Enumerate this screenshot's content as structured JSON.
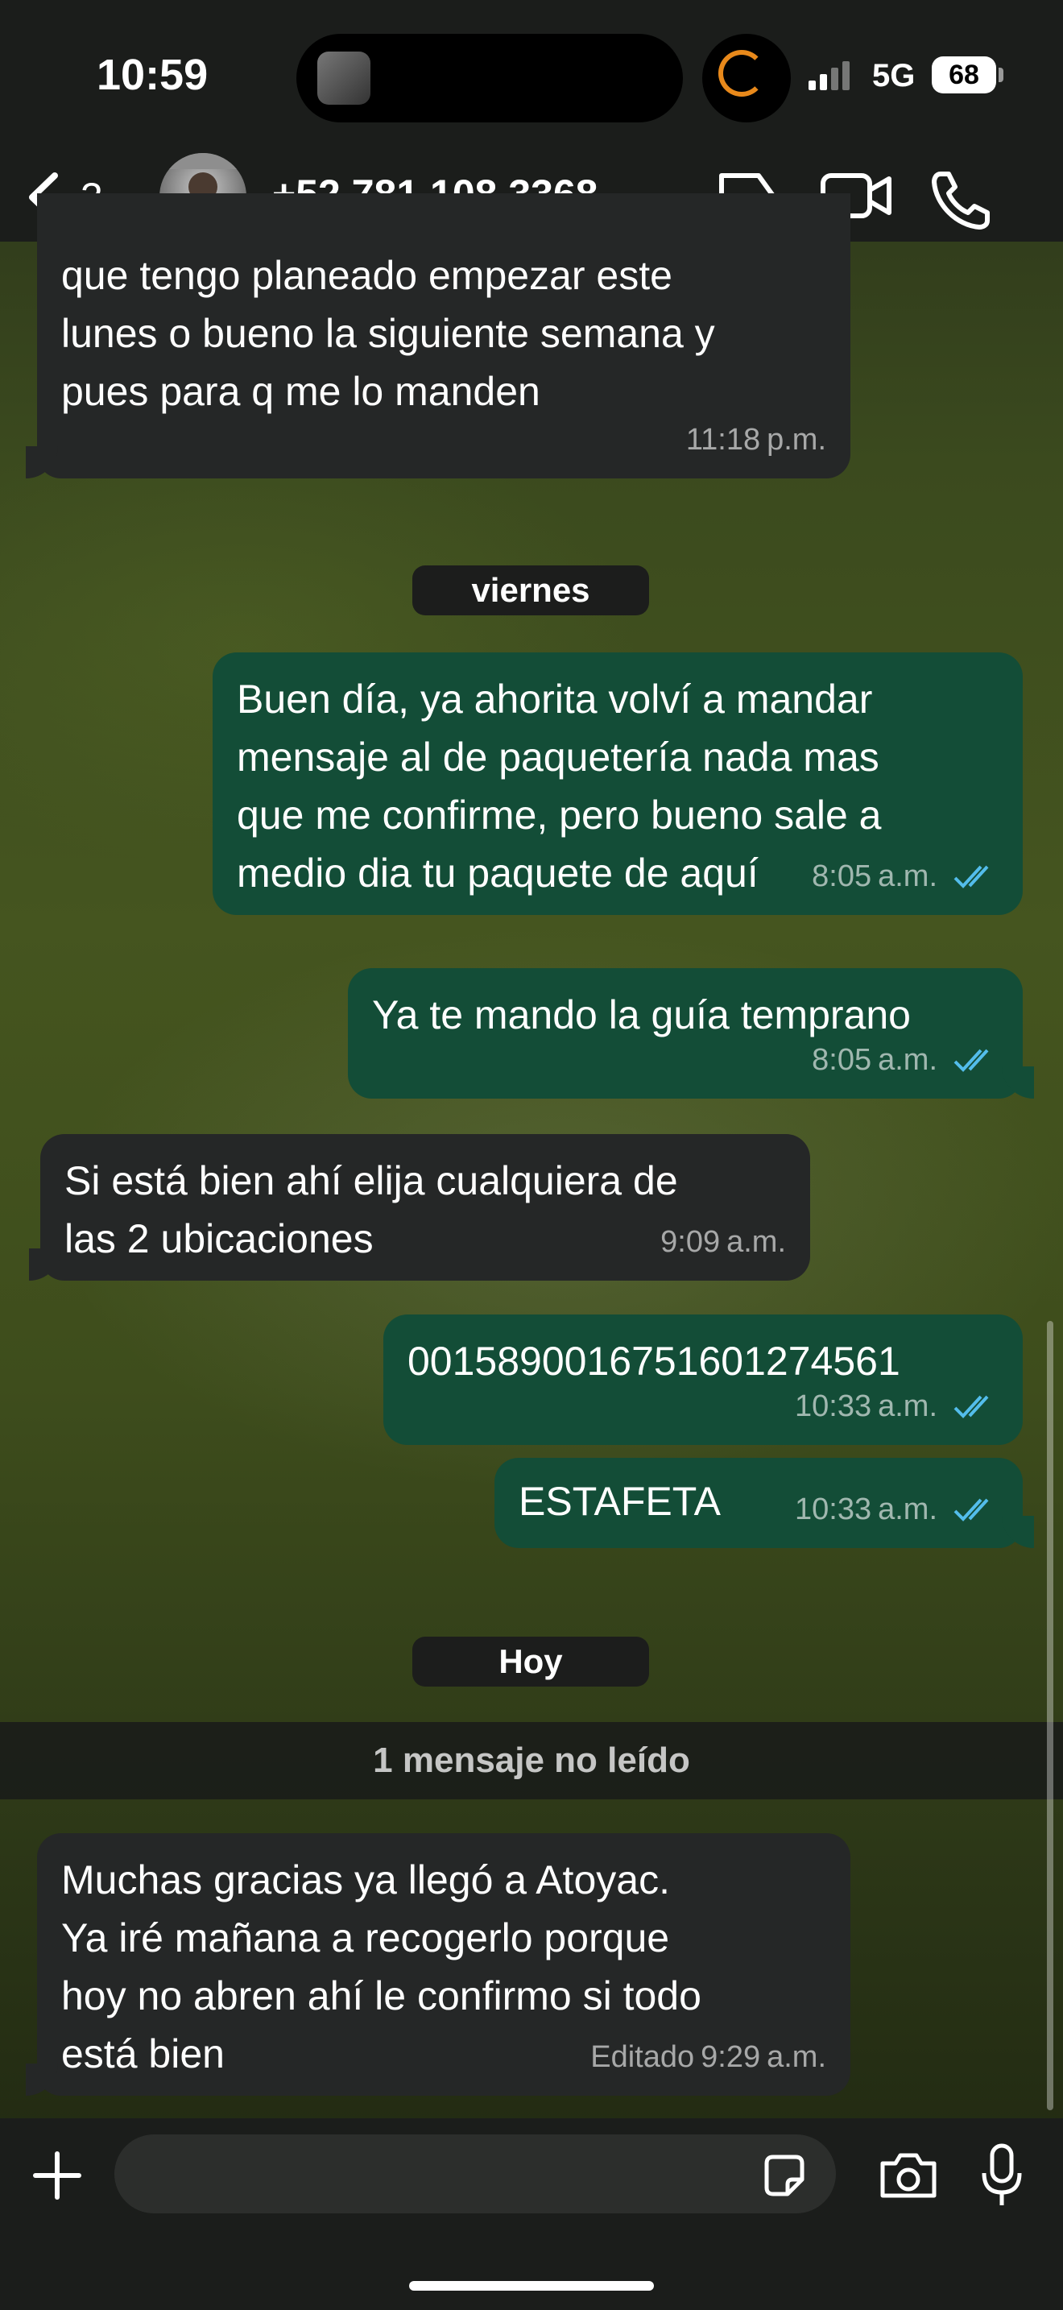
{
  "status_bar": {
    "time": "10:59",
    "network": "5G",
    "battery": "68"
  },
  "header": {
    "back_count": "3",
    "contact": "+52 781 108 3368"
  },
  "messages": [
    {
      "text_lines": [
        "que tengo planeado empezar este",
        "lunes o bueno la siguiente semana y",
        "pues para q me lo manden"
      ],
      "time": "11:18",
      "ampm": "p.m."
    },
    {
      "text_lines": [
        "Buen día, ya ahorita volví a mandar",
        "mensaje al de paquetería nada mas",
        "que me confirme, pero bueno sale a",
        "medio dia tu paquete de aquí"
      ],
      "time": "8:05",
      "ampm": "a.m."
    },
    {
      "text_lines": [
        "Ya te mando la guía temprano"
      ],
      "time": "8:05",
      "ampm": "a.m."
    },
    {
      "text_lines": [
        "Si está bien ahí elija cualquiera de",
        "las 2 ubicaciones"
      ],
      "time": "9:09",
      "ampm": "a.m."
    },
    {
      "text_lines": [
        "0015890016751601274561"
      ],
      "time": "10:33",
      "ampm": "a.m."
    },
    {
      "text_lines": [
        "ESTAFETA"
      ],
      "time": "10:33",
      "ampm": "a.m."
    },
    {
      "text_lines": [
        "Muchas gracias ya llegó a Atoyac.",
        "Ya iré mañana a recogerlo porque",
        "hoy no abren ahí le confirmo si todo",
        "está bien"
      ],
      "edited": "Editado",
      "time": "9:29",
      "ampm": "a.m."
    }
  ],
  "date_chips": {
    "friday": "viernes",
    "today": "Hoy"
  },
  "unread_banner": "1 mensaje no leído",
  "colors": {
    "incoming": "#252727",
    "outgoing": "#134d37",
    "read_ticks": "#53bdeb"
  }
}
